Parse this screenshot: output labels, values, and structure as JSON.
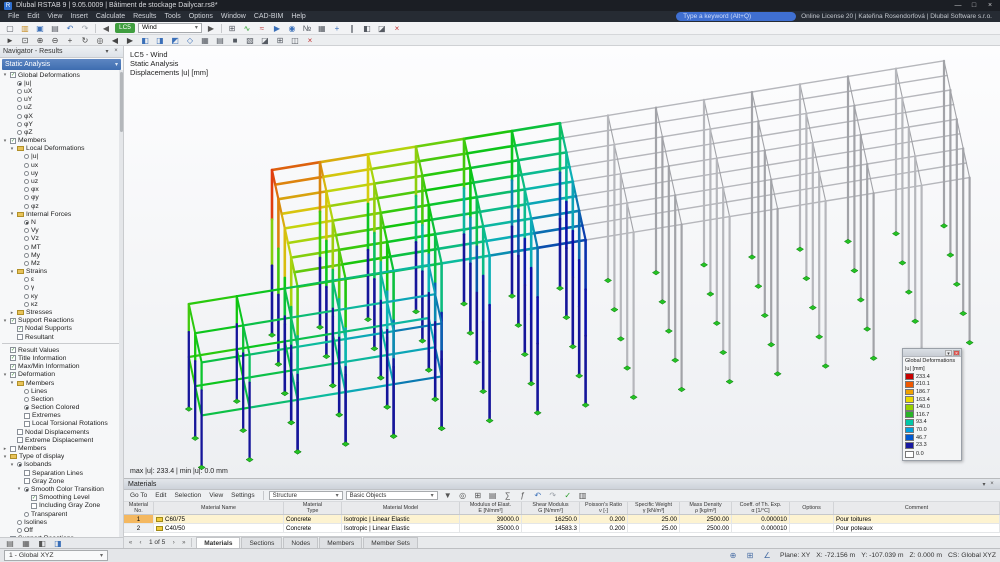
{
  "app": {
    "title": "Dlubal RSTAB 9 | 9.05.0009 | Bâtiment de stockage Dailycar.rs8*",
    "license": "Online License 20 | Kateřina Rosendorfová | Dlubal Software s.r.o.",
    "search_placeholder": "Type a keyword (Alt+Q)",
    "window_buttons": {
      "minimize": "—",
      "maximize": "□",
      "close": "×"
    },
    "app_initial": "R"
  },
  "menus": [
    "File",
    "Edit",
    "View",
    "Insert",
    "Calculate",
    "Results",
    "Tools",
    "Options",
    "Window",
    "CAD-BIM",
    "Help"
  ],
  "toolbar1": {
    "left_icons": [
      {
        "n": "new-icon",
        "g": "▢",
        "c": "#555a62"
      },
      {
        "n": "open-icon",
        "g": "▥",
        "c": "#c89028"
      },
      {
        "n": "save-icon",
        "g": "▣",
        "c": "#3a6fb8"
      },
      {
        "n": "print-icon",
        "g": "▤",
        "c": "#555a62"
      },
      {
        "n": "undo-icon",
        "g": "↶",
        "c": "#3a6fb8"
      },
      {
        "n": "redo-icon",
        "g": "↷",
        "c": "#9aa0a8"
      }
    ],
    "lc_prev": "◀",
    "lc_badge": "LC5",
    "lc_combo": "Wind",
    "lc_next": "▶",
    "right_icons": [
      {
        "n": "calculate-icon",
        "g": "⊞",
        "c": "#555a62"
      },
      {
        "n": "show-results-icon",
        "g": "∿",
        "c": "#2a9d2a"
      },
      {
        "n": "deformation-icon",
        "g": "≈",
        "c": "#c04040"
      },
      {
        "n": "animate-results-icon",
        "g": "▶",
        "c": "#3a6fb8"
      },
      {
        "n": "visibility-icon",
        "g": "◉",
        "c": "#3a6fb8"
      },
      {
        "n": "numbering-icon",
        "g": "№",
        "c": "#555a62"
      },
      {
        "n": "grid-icon",
        "g": "▦",
        "c": "#555a62"
      },
      {
        "n": "snap-icon",
        "g": "+",
        "c": "#3a6fb8"
      },
      {
        "n": "guidelines-icon",
        "g": "∥",
        "c": "#555a62"
      },
      {
        "n": "render-mode-icon",
        "g": "◧",
        "c": "#555a62"
      },
      {
        "n": "section-icon",
        "g": "◪",
        "c": "#555a62"
      },
      {
        "n": "stop-icon",
        "g": "×",
        "c": "#c03030"
      }
    ]
  },
  "toolbar2": {
    "icons": [
      {
        "n": "select-icon",
        "g": "►",
        "c": "#444"
      },
      {
        "n": "zoom-window-icon",
        "g": "⊡",
        "c": "#444"
      },
      {
        "n": "zoom-in-icon",
        "g": "⊕",
        "c": "#444"
      },
      {
        "n": "zoom-out-icon",
        "g": "⊖",
        "c": "#444"
      },
      {
        "n": "pan-icon",
        "g": "+",
        "c": "#444"
      },
      {
        "n": "rotate-view-icon",
        "g": "↻",
        "c": "#444"
      },
      {
        "n": "zoom-all-icon",
        "g": "◎",
        "c": "#444"
      },
      {
        "n": "previous-view-icon",
        "g": "◀",
        "c": "#444"
      },
      {
        "n": "next-view-icon",
        "g": "▶",
        "c": "#444"
      },
      {
        "n": "view-x-icon",
        "g": "◧",
        "c": "#3a6fb8"
      },
      {
        "n": "view-y-icon",
        "g": "◨",
        "c": "#3a6fb8"
      },
      {
        "n": "view-z-icon",
        "g": "◩",
        "c": "#3a6fb8"
      },
      {
        "n": "isometric-view-icon",
        "g": "◇",
        "c": "#3a6fb8"
      },
      {
        "n": "wireframe-icon",
        "g": "▦",
        "c": "#555a62"
      },
      {
        "n": "hidden-line-icon",
        "g": "▤",
        "c": "#555a62"
      },
      {
        "n": "solid-model-icon",
        "g": "■",
        "c": "#555a62"
      },
      {
        "n": "transparent-model-icon",
        "g": "▧",
        "c": "#555a62"
      },
      {
        "n": "shadow-icon",
        "g": "◪",
        "c": "#555a62"
      },
      {
        "n": "new-window-icon",
        "g": "⊞",
        "c": "#555a62"
      },
      {
        "n": "split-view-icon",
        "g": "◫",
        "c": "#555a62"
      },
      {
        "n": "close-view-icon",
        "g": "×",
        "c": "#c03030"
      }
    ]
  },
  "navigator": {
    "title": "Navigator - Results",
    "combo": "Static Analysis",
    "tree1": [
      {
        "t": "Global Deformations",
        "d": 0,
        "i": "check-on",
        "e": "open"
      },
      {
        "t": "|u|",
        "d": 1,
        "i": "radio-on"
      },
      {
        "t": "uX",
        "d": 1,
        "i": "radio-off"
      },
      {
        "t": "uY",
        "d": 1,
        "i": "radio-off"
      },
      {
        "t": "uZ",
        "d": 1,
        "i": "radio-off"
      },
      {
        "t": "φX",
        "d": 1,
        "i": "radio-off"
      },
      {
        "t": "φY",
        "d": 1,
        "i": "radio-off"
      },
      {
        "t": "φZ",
        "d": 1,
        "i": "radio-off"
      },
      {
        "t": "Members",
        "d": 0,
        "i": "check-on",
        "e": "open"
      },
      {
        "t": "Local Deformations",
        "d": 1,
        "i": "folder",
        "e": "open"
      },
      {
        "t": "|u|",
        "d": 2,
        "i": "radio-off"
      },
      {
        "t": "ux",
        "d": 2,
        "i": "radio-off"
      },
      {
        "t": "uy",
        "d": 2,
        "i": "radio-off"
      },
      {
        "t": "uz",
        "d": 2,
        "i": "radio-off"
      },
      {
        "t": "φx",
        "d": 2,
        "i": "radio-off"
      },
      {
        "t": "φy",
        "d": 2,
        "i": "radio-off"
      },
      {
        "t": "φz",
        "d": 2,
        "i": "radio-off"
      },
      {
        "t": "Internal Forces",
        "d": 1,
        "i": "folder",
        "e": "open"
      },
      {
        "t": "N",
        "d": 2,
        "i": "radio-on"
      },
      {
        "t": "Vy",
        "d": 2,
        "i": "radio-off"
      },
      {
        "t": "Vz",
        "d": 2,
        "i": "radio-off"
      },
      {
        "t": "MT",
        "d": 2,
        "i": "radio-off"
      },
      {
        "t": "My",
        "d": 2,
        "i": "radio-off"
      },
      {
        "t": "Mz",
        "d": 2,
        "i": "radio-off"
      },
      {
        "t": "Strains",
        "d": 1,
        "i": "folder",
        "e": "open"
      },
      {
        "t": "ε",
        "d": 2,
        "i": "radio-off"
      },
      {
        "t": "γ",
        "d": 2,
        "i": "radio-off"
      },
      {
        "t": "κy",
        "d": 2,
        "i": "radio-off"
      },
      {
        "t": "κz",
        "d": 2,
        "i": "radio-off"
      },
      {
        "t": "Stresses",
        "d": 1,
        "i": "folder",
        "e": "closed"
      },
      {
        "t": "Support Reactions",
        "d": 0,
        "i": "check-on",
        "e": "open"
      },
      {
        "t": "Nodal Supports",
        "d": 1,
        "i": "check-on"
      },
      {
        "t": "Resultant",
        "d": 1,
        "i": "check-off"
      }
    ],
    "tree2": [
      {
        "t": "Result Values",
        "d": 0,
        "i": "check-on"
      },
      {
        "t": "Title Information",
        "d": 0,
        "i": "check-on"
      },
      {
        "t": "Max/Min Information",
        "d": 0,
        "i": "check-on"
      },
      {
        "t": "Deformation",
        "d": 0,
        "i": "check-on",
        "e": "open"
      },
      {
        "t": "Members",
        "d": 1,
        "i": "folder",
        "e": "open"
      },
      {
        "t": "Lines",
        "d": 2,
        "i": "radio-off"
      },
      {
        "t": "Section",
        "d": 2,
        "i": "radio-off"
      },
      {
        "t": "Section Colored",
        "d": 2,
        "i": "radio-on"
      },
      {
        "t": "Extremes",
        "d": 2,
        "i": "check-off"
      },
      {
        "t": "Local Torsional Rotations",
        "d": 2,
        "i": "check-off"
      },
      {
        "t": "Nodal Displacements",
        "d": 1,
        "i": "check-off"
      },
      {
        "t": "Extreme Displacement",
        "d": 1,
        "i": "check-off"
      },
      {
        "t": "Members",
        "d": 0,
        "i": "check-off",
        "e": "closed"
      },
      {
        "t": "Type of display",
        "d": 0,
        "i": "folder",
        "e": "open"
      },
      {
        "t": "Isobands",
        "d": 1,
        "i": "radio-on",
        "e": "open"
      },
      {
        "t": "Separation Lines",
        "d": 2,
        "i": "check-off"
      },
      {
        "t": "Gray Zone",
        "d": 2,
        "i": "check-off"
      },
      {
        "t": "Smooth Color Transition",
        "d": 2,
        "i": "radio-on",
        "e": "open"
      },
      {
        "t": "Smoothing Level",
        "d": 3,
        "i": "check-on"
      },
      {
        "t": "Including Gray Zone",
        "d": 3,
        "i": "check-off"
      },
      {
        "t": "Transparent",
        "d": 2,
        "i": "radio-off"
      },
      {
        "t": "Isolines",
        "d": 1,
        "i": "radio-off"
      },
      {
        "t": "Off",
        "d": 1,
        "i": "radio-off"
      },
      {
        "t": "Support Reactions",
        "d": 0,
        "i": "check-on",
        "e": "closed"
      }
    ],
    "bottom_icons": [
      {
        "n": "navigator-tab-data",
        "g": "▤",
        "c": "#555"
      },
      {
        "n": "navigator-tab-display",
        "g": "▦",
        "c": "#555"
      },
      {
        "n": "navigator-tab-views",
        "g": "◧",
        "c": "#555"
      },
      {
        "n": "navigator-tab-results",
        "g": "◨",
        "c": "#3a6fb8"
      }
    ]
  },
  "viewport": {
    "load_case": "LC5 - Wind",
    "analysis": "Static Analysis",
    "result": "Displacements |u| [mm]",
    "maxmin": "max |u|: 233.4 | min |u|: 0.0 mm"
  },
  "legend": {
    "title": "Global Deformations",
    "unit": "|u| [mm]",
    "values": [
      "233.4",
      "210.1",
      "186.7",
      "163.4",
      "140.0",
      "116.7",
      "93.4",
      "70.0",
      "46.7",
      "23.3"
    ],
    "min_value": "0.0",
    "colors": [
      "#c80000",
      "#f05800",
      "#f0a000",
      "#ead800",
      "#96d000",
      "#28b428",
      "#00c8a8",
      "#00a0e0",
      "#0058d0",
      "#1818a0"
    ]
  },
  "materials": {
    "title": "Materials",
    "menu": [
      "Go To",
      "Edit",
      "Selection",
      "View",
      "Settings"
    ],
    "combo_structure": "Structure",
    "combo_objects": "Basic Objects",
    "icons": [
      {
        "n": "table-filter-icon",
        "g": "▼",
        "c": "#555"
      },
      {
        "n": "table-search-icon",
        "g": "◎",
        "c": "#555"
      },
      {
        "n": "table-copy-icon",
        "g": "⊞",
        "c": "#555"
      },
      {
        "n": "table-export-icon",
        "g": "▤",
        "c": "#555"
      },
      {
        "n": "table-sum-icon",
        "g": "∑",
        "c": "#555"
      },
      {
        "n": "table-function-icon",
        "g": "ƒ",
        "c": "#555"
      },
      {
        "n": "table-undo-icon",
        "g": "↶",
        "c": "#3a6fb8"
      },
      {
        "n": "table-redo-icon",
        "g": "↷",
        "c": "#9aa0a8"
      },
      {
        "n": "table-check-icon",
        "g": "✓",
        "c": "#2a9d2a"
      },
      {
        "n": "table-print-icon",
        "g": "▥",
        "c": "#555"
      }
    ],
    "headers": [
      {
        "l1": "Material",
        "l2": "No."
      },
      {
        "l1": "Material Name",
        "l2": ""
      },
      {
        "l1": "Material",
        "l2": "Type"
      },
      {
        "l1": "Material Model",
        "l2": ""
      },
      {
        "l1": "Modulus of Elast.",
        "l2": "E [N/mm²]"
      },
      {
        "l1": "Shear Modulus",
        "l2": "G [N/mm²]"
      },
      {
        "l1": "Poisson's Ratio",
        "l2": "ν [-]"
      },
      {
        "l1": "Specific Weight",
        "l2": "γ [kN/m³]"
      },
      {
        "l1": "Mass Density",
        "l2": "ρ [kg/m³]"
      },
      {
        "l1": "Coeff. of Th. Exp.",
        "l2": "α [1/°C]"
      },
      {
        "l1": "Options",
        "l2": ""
      },
      {
        "l1": "Comment",
        "l2": ""
      }
    ],
    "rows": [
      [
        "1",
        "C60/75",
        "Concrete",
        "Isotropic | Linear Elastic",
        "39000.0",
        "16250.0",
        "0.200",
        "25.00",
        "2500.00",
        "0.000010",
        "",
        "Pour toitures"
      ],
      [
        "2",
        "C40/50",
        "Concrete",
        "Isotropic | Linear Elastic",
        "35000.0",
        "14583.3",
        "0.200",
        "25.00",
        "2500.00",
        "0.000010",
        "",
        "Pour poteaux"
      ]
    ],
    "swatch_color": "#f2cc3a",
    "pager": {
      "first": "«",
      "prev": "‹",
      "label": "1 of 5",
      "next": "›",
      "last": "»"
    },
    "tabs": [
      "Materials",
      "Sections",
      "Nodes",
      "Members",
      "Member Sets"
    ],
    "active_tab": "Materials"
  },
  "statusbar": {
    "view": "1 - Global XYZ",
    "icons": [
      {
        "n": "status-snap-icon",
        "g": "⊕",
        "c": "#4a6fa5"
      },
      {
        "n": "status-grid-icon",
        "g": "⊞",
        "c": "#4a6fa5"
      },
      {
        "n": "status-osnap-icon",
        "g": "∠",
        "c": "#4a6fa5"
      }
    ],
    "plane": "Plane: XY",
    "x": "X: -72.156 m",
    "y": "Y: -107.039 m",
    "z": "Z: 0.000 m",
    "cs": "CS: Global XYZ"
  },
  "structure": {
    "origin": [
      272,
      170
    ],
    "e1": [
      48,
      -7.8
    ],
    "e2": [
      3.2,
      14.6
    ],
    "bays_long": 14,
    "bays_wide": 8,
    "col_height": 165,
    "colored_bays": 6,
    "gray": "#b6b7bc",
    "gray_dark": "#a2a3a8",
    "deep_blue": "#15159a",
    "support": "#24c224",
    "support_dark": "#0e7a0e",
    "mezz": {
      "u0": -2,
      "u1": 3,
      "v0": 4,
      "v1": 8,
      "deck1": 105,
      "deck2": 52
    }
  }
}
